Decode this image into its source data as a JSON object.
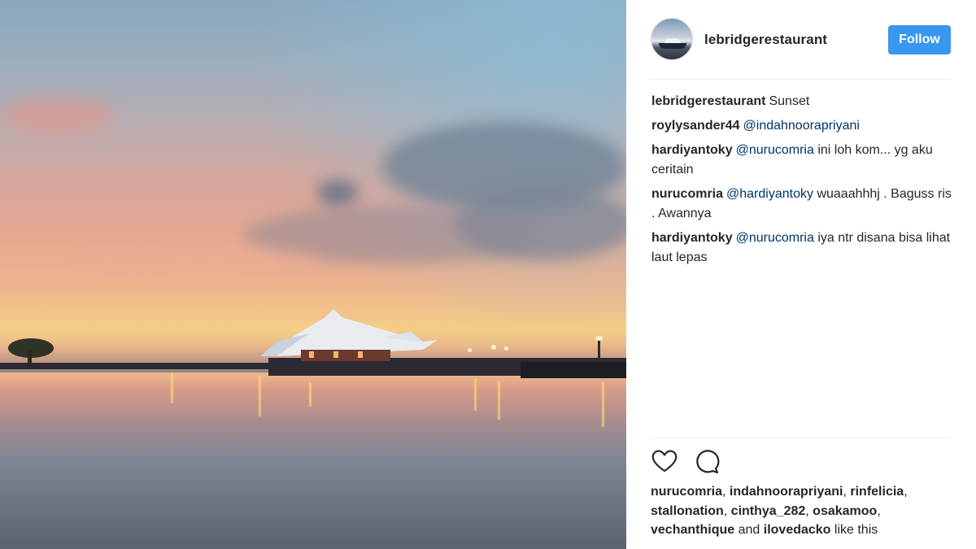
{
  "post": {
    "image_description_icon": "sunset-harbor-photo"
  },
  "header": {
    "username": "lebridgerestaurant",
    "follow_label": "Follow"
  },
  "comments": [
    {
      "author": "lebridgerestaurant",
      "mention": "",
      "text": "Sunset"
    },
    {
      "author": "roylysander44",
      "mention": "@indahnoorapriyani",
      "text": ""
    },
    {
      "author": "hardiyantoky",
      "mention": "@nurucomria",
      "text": "ini loh kom... yg aku ceritain"
    },
    {
      "author": "nurucomria",
      "mention": "@hardiyantoky",
      "text": "wuaaahhhj . Baguss ris . Awannya"
    },
    {
      "author": "hardiyantoky",
      "mention": "@nurucomria",
      "text": "iya ntr disana bisa lihat laut lepas"
    }
  ],
  "actions": {
    "like_icon": "heart-icon",
    "comment_icon": "comment-icon"
  },
  "likes": {
    "users": [
      "nurucomria",
      "indahnoorapriyani",
      "rinfelicia",
      "stallonation",
      "cinthya_282",
      "osakamoo",
      "vechanthique"
    ],
    "last_user": "ilovedacko",
    "and_word": "and",
    "suffix": "like this"
  },
  "colors": {
    "follow_button": "#3897f0",
    "mention": "#003569",
    "text": "#262626"
  }
}
